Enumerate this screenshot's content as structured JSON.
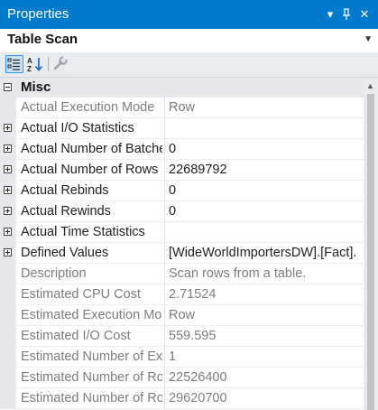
{
  "window": {
    "title": "Properties",
    "dropdown_glyph": "▾",
    "pin_glyph": "❙",
    "close_glyph": "✕"
  },
  "object_selector": {
    "value": "Table Scan",
    "arrow_glyph": "▼"
  },
  "toolbar": {
    "buttons": [
      {
        "name": "categorized-view-icon",
        "active": true
      },
      {
        "name": "alphabetical-sort-icon",
        "active": false
      },
      {
        "name": "property-pages-icon",
        "active": false
      }
    ]
  },
  "grid": {
    "category": "Misc",
    "rows": [
      {
        "name": "Actual Execution Mode",
        "value": "Row",
        "readonly": true,
        "expandable": false
      },
      {
        "name": "Actual I/O Statistics",
        "value": "",
        "readonly": false,
        "expandable": true
      },
      {
        "name": "Actual Number of Batches",
        "value": "0",
        "readonly": false,
        "expandable": true
      },
      {
        "name": "Actual Number of Rows",
        "value": "22689792",
        "readonly": false,
        "expandable": true
      },
      {
        "name": "Actual Rebinds",
        "value": "0",
        "readonly": false,
        "expandable": true
      },
      {
        "name": "Actual Rewinds",
        "value": "0",
        "readonly": false,
        "expandable": true
      },
      {
        "name": "Actual Time Statistics",
        "value": "",
        "readonly": false,
        "expandable": true
      },
      {
        "name": "Defined Values",
        "value": "[WideWorldImportersDW].[Fact].",
        "readonly": false,
        "expandable": true
      },
      {
        "name": "Description",
        "value": "Scan rows from a table.",
        "readonly": true,
        "expandable": false
      },
      {
        "name": "Estimated CPU Cost",
        "value": "2.71524",
        "readonly": true,
        "expandable": false
      },
      {
        "name": "Estimated Execution Mode",
        "value": "Row",
        "readonly": true,
        "expandable": false
      },
      {
        "name": "Estimated I/O Cost",
        "value": "559.595",
        "readonly": true,
        "expandable": false
      },
      {
        "name": "Estimated Number of Executions",
        "value": "1",
        "readonly": true,
        "expandable": false
      },
      {
        "name": "Estimated Number of Rows",
        "value": "22526400",
        "readonly": true,
        "expandable": false
      },
      {
        "name": "Estimated Number of Rows to be Read",
        "value": "29620700",
        "readonly": true,
        "expandable": false
      }
    ]
  },
  "colors": {
    "title_bar": "#007acc",
    "readonly_text": "#7d7d7d",
    "normal_text": "#1e1e1e"
  }
}
